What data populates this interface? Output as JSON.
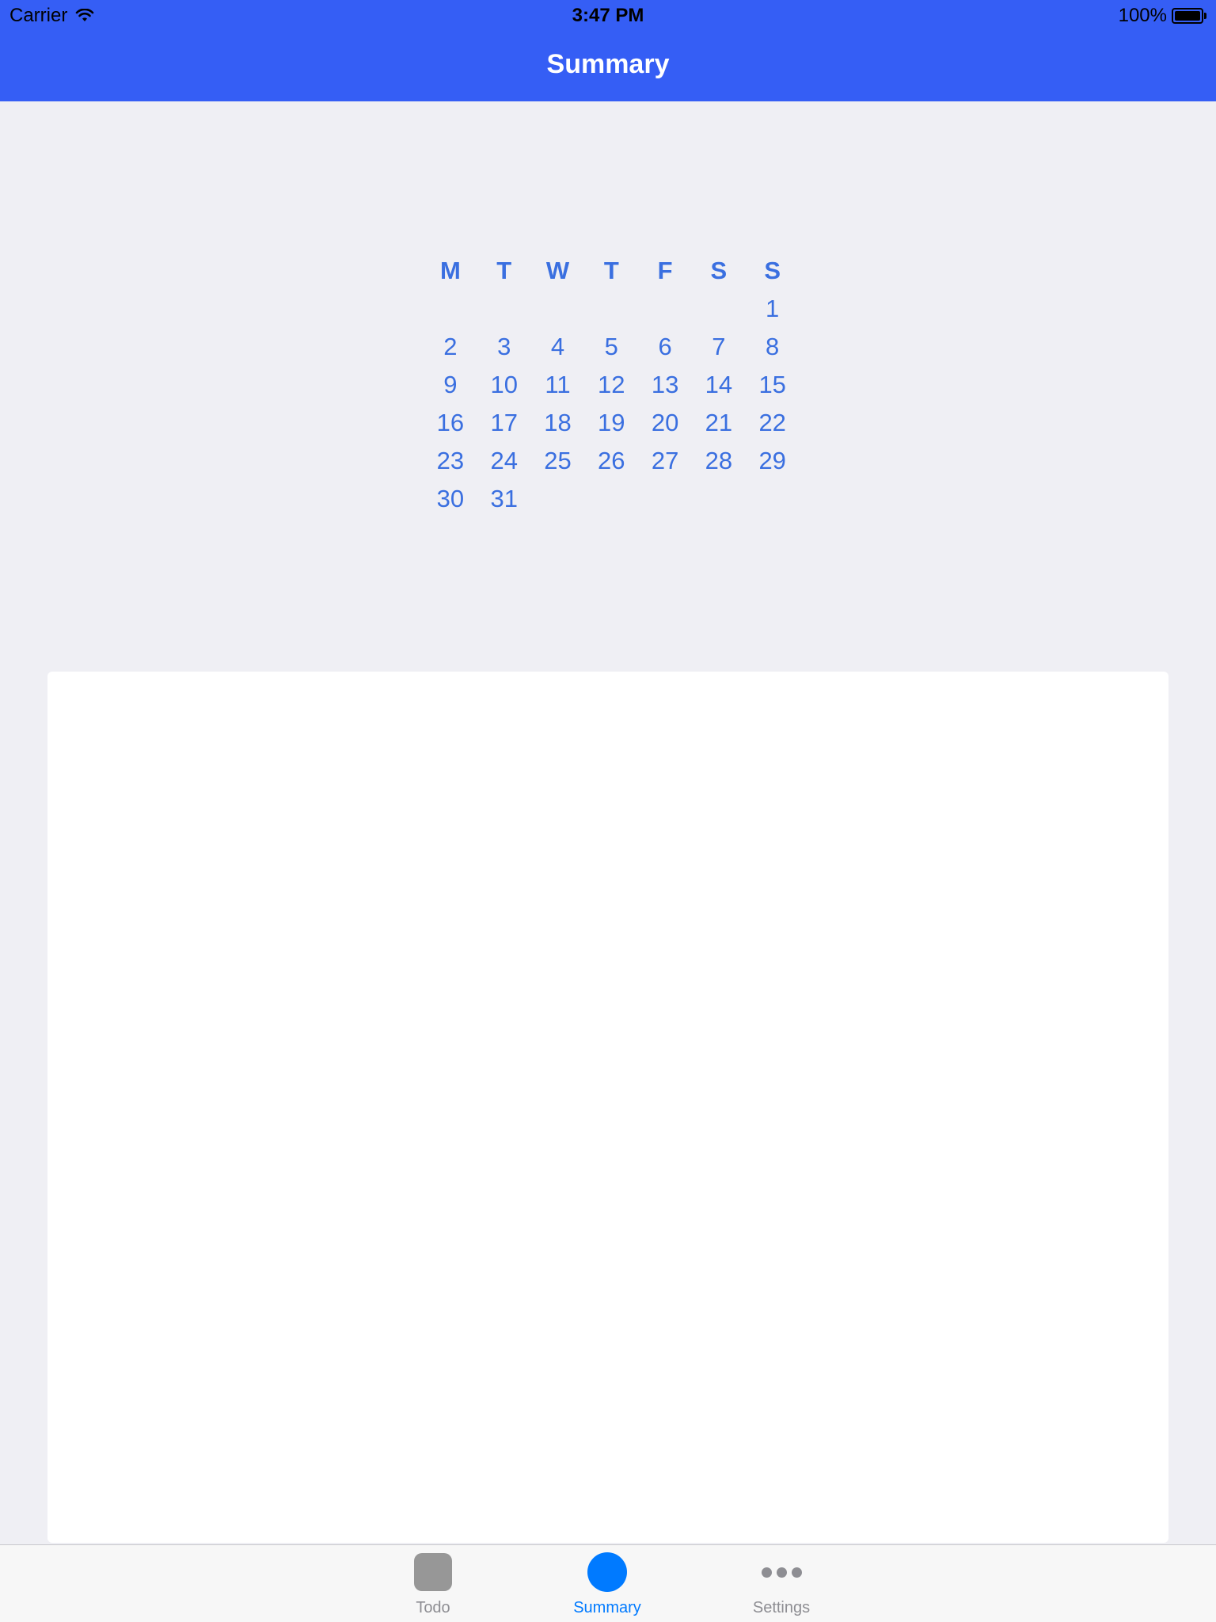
{
  "status_bar": {
    "carrier": "Carrier",
    "time": "3:47 PM",
    "battery": "100%",
    "battery_level": 1.0
  },
  "nav": {
    "title": "Summary"
  },
  "calendar": {
    "weekdays": [
      "M",
      "T",
      "W",
      "T",
      "F",
      "S",
      "S"
    ],
    "weeks": [
      [
        "",
        "",
        "",
        "",
        "",
        "",
        "1"
      ],
      [
        "2",
        "3",
        "4",
        "5",
        "6",
        "7",
        "8"
      ],
      [
        "9",
        "10",
        "11",
        "12",
        "13",
        "14",
        "15"
      ],
      [
        "16",
        "17",
        "18",
        "19",
        "20",
        "21",
        "22"
      ],
      [
        "23",
        "24",
        "25",
        "26",
        "27",
        "28",
        "29"
      ],
      [
        "30",
        "31",
        "",
        "",
        "",
        "",
        ""
      ]
    ]
  },
  "tab_bar": {
    "tabs": [
      {
        "label": "Todo",
        "icon": "todo-icon",
        "active": false
      },
      {
        "label": "Summary",
        "icon": "summary-icon",
        "active": true
      },
      {
        "label": "Settings",
        "icon": "more-icon",
        "active": false
      }
    ]
  },
  "colors": {
    "nav_bar": "#355ef5",
    "calendar_text": "#3a6fe0",
    "tab_active": "#007aff",
    "tab_inactive": "#8e8e93",
    "background": "#efeff4"
  }
}
